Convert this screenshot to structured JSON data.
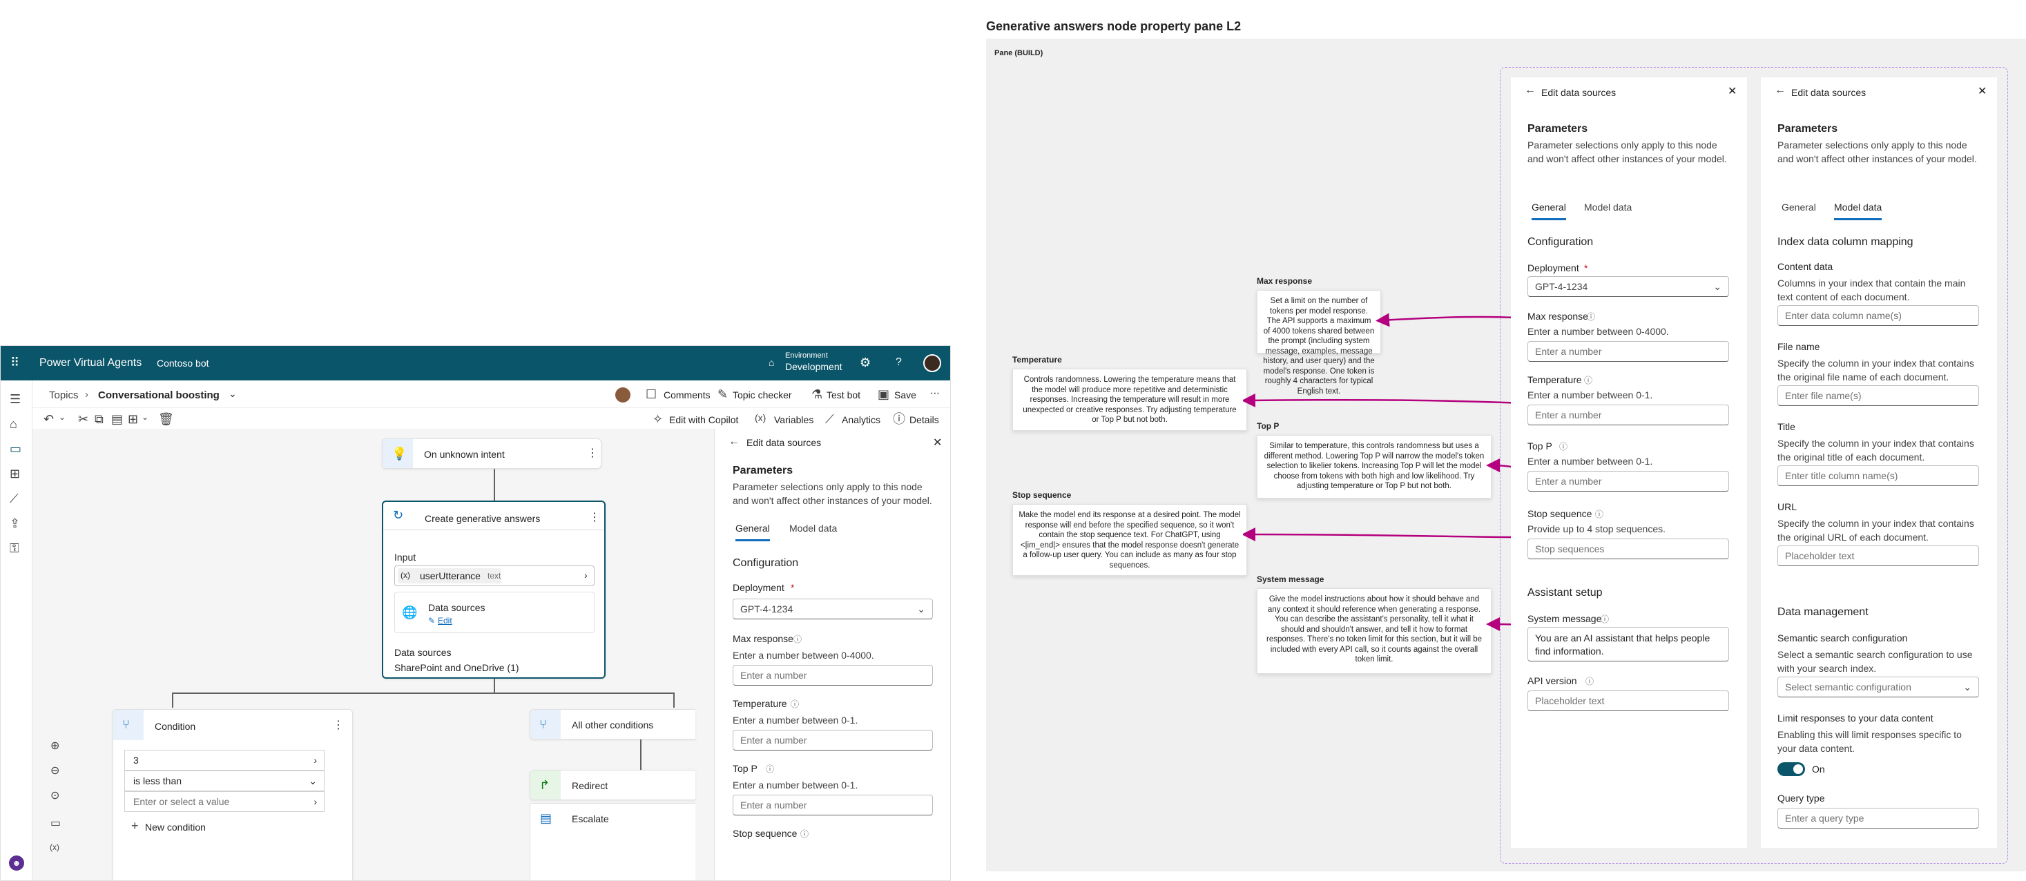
{
  "app": {
    "name": "Power Virtual Agents",
    "bot": "Contoso bot",
    "environment_label": "Environment",
    "environment_value": "Development",
    "breadcrumb_root": "Topics",
    "breadcrumb_current": "Conversational boosting",
    "toolbar": {
      "comments": "Comments",
      "topic_checker": "Topic checker",
      "test_bot": "Test bot",
      "save": "Save",
      "edit_copilot": "Edit with Copilot",
      "variables": "Variables",
      "analytics": "Analytics",
      "details": "Details"
    },
    "canvas": {
      "trigger": "On unknown intent",
      "gen_node_title": "Create generative answers",
      "input_label": "Input",
      "input_var": "userUtterance",
      "input_type": "text",
      "data_sources_card": "Data sources",
      "edit_link": "Edit",
      "data_sources_label": "Data sources",
      "data_sources_value": "SharePoint and OneDrive (1)",
      "condition_title": "Condition",
      "cond_value": "3",
      "cond_op": "is less than",
      "cond_placeholder": "Enter or select a value",
      "new_condition": "New condition",
      "other_title": "All other conditions",
      "redirect": "Redirect",
      "escalate": "Escalate"
    }
  },
  "design": {
    "title": "Generative answers node property pane L2",
    "pane_label": "Pane (BUILD)"
  },
  "panel": {
    "header": "Edit data sources",
    "params_title": "Parameters",
    "params_desc": "Parameter selections only apply to this node and won't affect other instances of your model.",
    "tab_general": "General",
    "tab_model": "Model data",
    "configuration": "Configuration",
    "deployment_label": "Deployment",
    "deployment_value": "GPT-4-1234",
    "max_response_label": "Max response",
    "max_response_hint": "Enter a number between 0-4000.",
    "temperature_label": "Temperature",
    "temperature_hint": "Enter a number between 0-1.",
    "top_p_label": "Top P",
    "top_p_hint": "Enter a number between 0-1.",
    "stop_label": "Stop sequence",
    "stop_hint": "Provide up to 4 stop sequences.",
    "stop_placeholder": "Stop sequences",
    "number_placeholder": "Enter a number",
    "assistant_setup": "Assistant setup",
    "system_message_label": "System message",
    "system_message_value": "You are an AI assistant that helps people find information.",
    "api_version_label": "API version",
    "api_version_placeholder": "Placeholder text",
    "mini_stop": "Stop sequence"
  },
  "model_panel": {
    "index_title": "Index data column mapping",
    "content_label": "Content data",
    "content_desc": "Columns in your index that contain the main text content of each document.",
    "content_ph": "Enter data column name(s)",
    "file_label": "File name",
    "file_desc": "Specify the column in your index that contains the original file name of each document.",
    "file_ph": "Enter file name(s)",
    "title_label": "Title",
    "title_desc": "Specify the column in your index that contains the original title of each document.",
    "title_ph": "Enter title column name(s)",
    "url_label": "URL",
    "url_desc": "Specify the column in your index that contains the original URL of each document.",
    "url_ph": "Placeholder text",
    "data_mgmt": "Data management",
    "semantic_label": "Semantic search configuration",
    "semantic_desc": "Select a semantic search configuration to use with your search index.",
    "semantic_ph": "Select semantic configuration",
    "limit_label": "Limit responses to your data content",
    "limit_desc": "Enabling this will limit responses specific to your data content.",
    "toggle_label": "On",
    "query_label": "Query type",
    "query_ph": "Enter a query type"
  },
  "callouts": {
    "max_title": "Max response",
    "max_text": "Set a limit on the number of tokens per model response. The API supports a maximum of 4000 tokens shared between the prompt (including system message, examples, message history, and user query) and the model's response. One token is roughly 4 characters for typical English text.",
    "temp_title": "Temperature",
    "temp_text": "Controls randomness. Lowering the temperature means that the model will produce more repetitive and deterministic responses. Increasing the temperature will result in more unexpected or creative responses. Try adjusting temperature or Top P but not both.",
    "topp_title": "Top P",
    "topp_text": "Similar to temperature, this controls randomness but uses a different method. Lowering Top P will narrow the model's token selection to likelier tokens. Increasing Top P will let the model choose from tokens with both high and low likelihood. Try adjusting temperature or Top P but not both.",
    "stop_title": "Stop sequence",
    "stop_text": "Make the model end its response at a desired point. The model response will end before the specified sequence, so it won't contain the stop sequence text. For ChatGPT, using <|im_end|> ensures that the model response doesn't generate a follow-up user query. You can include as many as four stop sequences.",
    "sys_title": "System message",
    "sys_text": "Give the model instructions about how it should behave and any context it should reference when generating a response. You can describe the assistant's personality, tell it what it should and shouldn't answer, and tell it how to format responses. There's no token limit for this section, but it will be included with every API call, so it counts against the overall token limit."
  },
  "colors": {
    "topbar": "#0b556a",
    "accent": "#0f6cbd",
    "arrow": "#b4007e",
    "dashed": "#b58de6"
  }
}
